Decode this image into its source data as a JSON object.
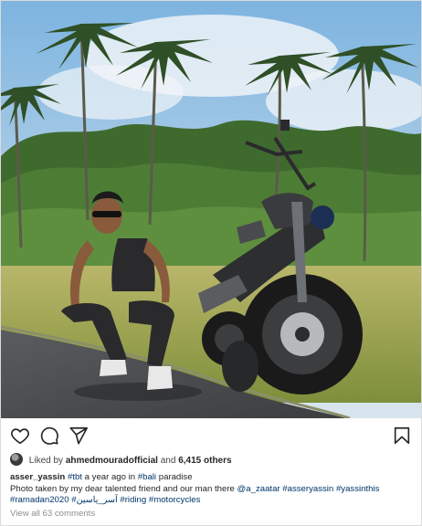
{
  "post": {
    "liked_by": {
      "prefix": "Liked by",
      "user": "ahmedmouradofficial",
      "and": "and",
      "count": "6,415 others"
    },
    "caption": {
      "username": "asser_yassin",
      "tag_tbt": "#tbt",
      "text_1": "a year ago in",
      "tag_bali": "#bali",
      "text_2": "paradise",
      "line2_text": "Photo taken by my dear talented friend and our man there",
      "mention": "@a_zaatar",
      "tag_asseryassin": "#asseryassin",
      "tag_yassinthis": "#yassinthis",
      "tag_ramadan": "#ramadan2020",
      "tag_arabic": "#آسر_ياسين",
      "tag_riding": "#riding",
      "tag_motorcycles": "#motorcycles"
    },
    "view_all_comments": "View all 63 comments"
  },
  "icons": {
    "like": "heart-icon",
    "comment": "comment-icon",
    "share": "paper-plane-icon",
    "save": "bookmark-icon"
  }
}
